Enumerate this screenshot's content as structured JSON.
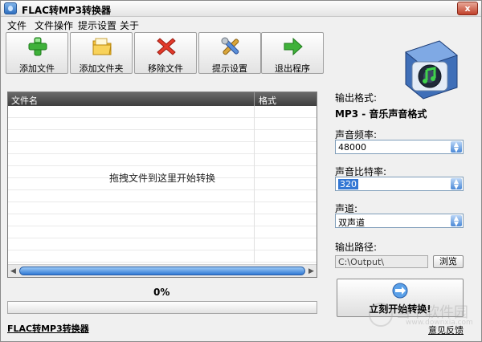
{
  "window": {
    "title": "FLAC转MP3转换器",
    "close_label": "x"
  },
  "menu": [
    "文件",
    "文件操作",
    "提示设置",
    "关于"
  ],
  "toolbar": [
    {
      "label": "添加文件",
      "icon": "green-plus-icon"
    },
    {
      "label": "添加文件夹",
      "icon": "folder-icon"
    },
    {
      "label": "移除文件",
      "icon": "red-x-icon"
    },
    {
      "label": "提示设置",
      "icon": "tools-icon"
    },
    {
      "label": "退出程序",
      "icon": "exit-arrow-icon"
    }
  ],
  "file_list": {
    "columns": [
      "文件名",
      "格式"
    ],
    "drop_hint": "拖拽文件到这里开始转换"
  },
  "progress": {
    "percent_label": "0%",
    "value": 0
  },
  "settings": {
    "output_format_label": "输出格式:",
    "output_format_value": "MP3 - 音乐声音格式",
    "sample_rate_label": "声音频率:",
    "sample_rate_value": "48000",
    "bitrate_label": "声音比特率:",
    "bitrate_value": "320",
    "channel_label": "声道:",
    "channel_value": "双声道",
    "output_path_label": "输出路径:",
    "output_path_value": "C:\\Output\\",
    "browse_label": "浏览"
  },
  "start_button": {
    "label": "立刻开始转换!"
  },
  "footer": {
    "app_link": "FLAC转MP3转换器",
    "feedback": "意见反馈"
  },
  "watermark": {
    "big": "当下软件园",
    "small": "www.downxia.com"
  }
}
